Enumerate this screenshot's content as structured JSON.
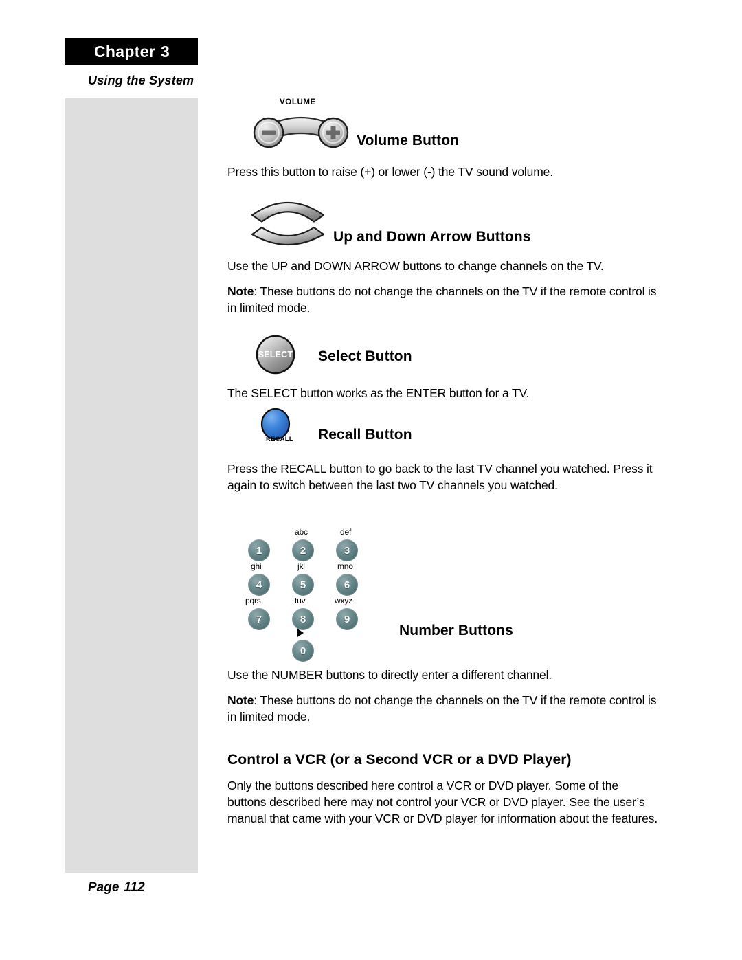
{
  "header": {
    "chapter_label": "Chapter",
    "chapter_number": "3",
    "subtitle": "Using the System"
  },
  "footer": {
    "page_label": "Page",
    "page_number": "112"
  },
  "sections": [
    {
      "id": "volume",
      "heading": "Volume Button",
      "graphic_label": "VOLUME",
      "body": "Press this button to raise (+) or lower (-) the TV sound volume."
    },
    {
      "id": "arrows",
      "heading": "Up and Down Arrow Buttons",
      "body": "Use the UP and DOWN ARROW buttons to change channels on the TV.",
      "note_label": "Note",
      "note_body": ": These buttons do not change the channels on the TV if the remote control is in limited mode."
    },
    {
      "id": "select",
      "heading": "Select Button",
      "graphic_label": "SELECT",
      "body": "The SELECT button works as the ENTER button for a TV."
    },
    {
      "id": "recall",
      "heading": "Recall Button",
      "graphic_label": "RECALL",
      "body": "Press the RECALL button to go back to the last TV channel you watched. Press it again to switch between the last two TV channels you watched."
    },
    {
      "id": "numbers",
      "heading": "Number Buttons",
      "body": "Use the NUMBER buttons to directly enter a different channel.",
      "note_label": "Note",
      "note_body": ": These buttons do not change the channels on the TV if the remote control is in limited mode."
    },
    {
      "id": "vcr",
      "heading": "Control a VCR (or a Second VCR or a DVD Player)",
      "body": "Only the buttons described here control a VCR or DVD player. Some of the buttons described here may not control your VCR or DVD player. See the user’s manual that came with your VCR or DVD player for information about the features."
    }
  ],
  "keypad": {
    "keys": [
      {
        "digit": "1",
        "letters": ""
      },
      {
        "digit": "2",
        "letters": "abc"
      },
      {
        "digit": "3",
        "letters": "def"
      },
      {
        "digit": "4",
        "letters": "ghi"
      },
      {
        "digit": "5",
        "letters": "jkl"
      },
      {
        "digit": "6",
        "letters": "mno"
      },
      {
        "digit": "7",
        "letters": "pqrs"
      },
      {
        "digit": "8",
        "letters": "tuv"
      },
      {
        "digit": "9",
        "letters": "wxyz"
      },
      {
        "digit": "0",
        "letters": ""
      }
    ],
    "play_symbol": "▶"
  },
  "colors": {
    "chapter_bar_bg": "#000000",
    "sidebar_bg": "#dedede",
    "keypad_button": "#5f7d80",
    "recall_button": "#3b7fd4",
    "select_button": "#9a9a9a",
    "text": "#000000"
  }
}
